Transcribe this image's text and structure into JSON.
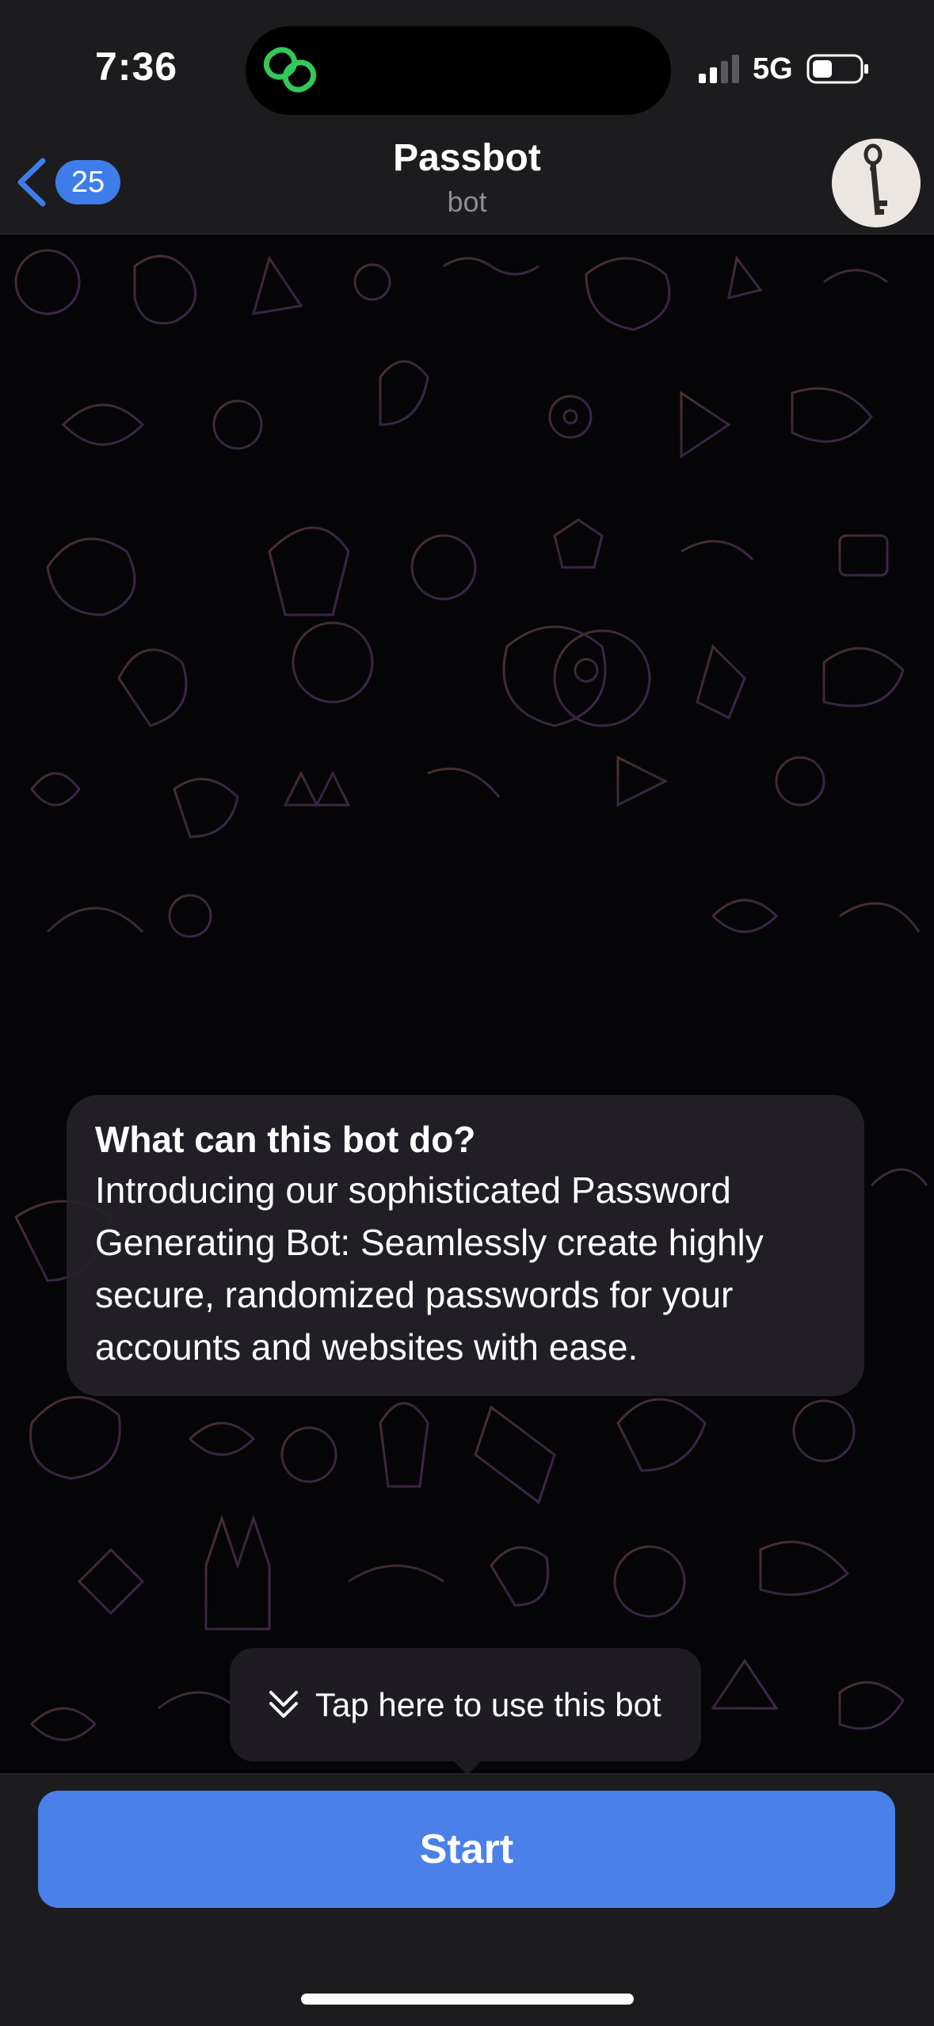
{
  "status_bar": {
    "time": "7:36",
    "network": "5G",
    "icons": [
      "app-link-icon",
      "signal-icon",
      "battery-icon"
    ]
  },
  "header": {
    "back_count": "25",
    "title": "Passbot",
    "subtitle": "bot",
    "avatar": "key-avatar-icon"
  },
  "bot_info": {
    "title": "What can this bot do?",
    "body": "Introducing our sophisticated Password Generating Bot: Seamlessly create highly secure, randomized passwords for your accounts and websites with ease."
  },
  "tooltip": {
    "text": "Tap here to use this bot",
    "icon": "double-chevron-down-icon"
  },
  "bottom": {
    "start_label": "Start"
  },
  "colors": {
    "accent": "#4a80e8",
    "badge": "#3e7de9",
    "bar_background": "#1c1c1e",
    "island_icon": "#34c759"
  }
}
